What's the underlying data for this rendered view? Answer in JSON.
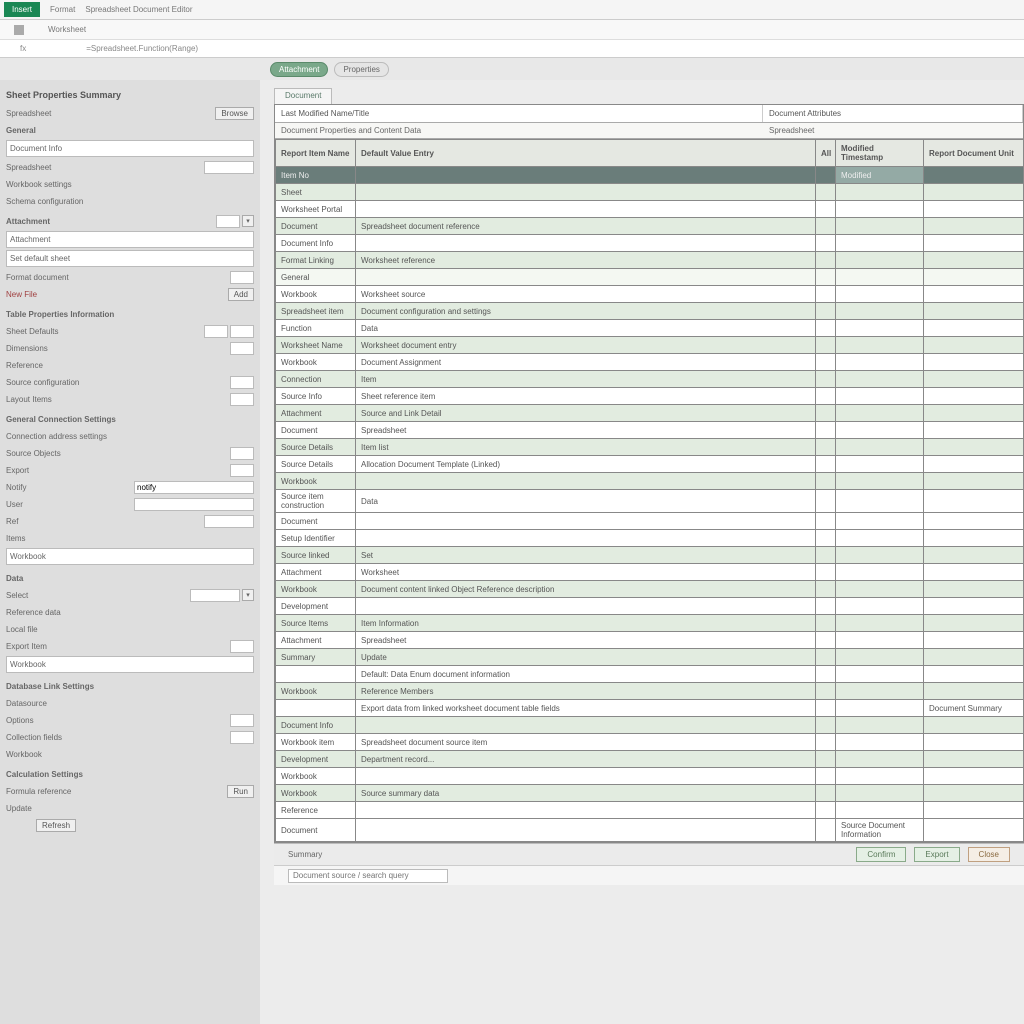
{
  "titlebar": {
    "tab": "Insert",
    "text1": "Format",
    "text2": "Spreadsheet Document Editor"
  },
  "ribbon": {
    "name": "Worksheet"
  },
  "formula": {
    "fx": "fx",
    "content": "=Spreadsheet.Function(Range)"
  },
  "chips": {
    "c1": "Attachment",
    "c2": "Properties"
  },
  "sidebar": {
    "title": "Sheet Properties Summary",
    "sub": "Spreadsheet",
    "group1_h": "General",
    "r1": {
      "label": "Document Info",
      "btn": "Browse"
    },
    "r2": {
      "label": "Spreadsheet"
    },
    "r3": {
      "label": "Workbook settings"
    },
    "r4": {
      "label": "Schema configuration"
    },
    "g2h": "Attachment",
    "r5": {
      "label": "Attachment"
    },
    "r6": {
      "label": "Set default sheet"
    },
    "r7": {
      "label": "Format document"
    },
    "r8": {
      "label": "New File",
      "btn": "Add"
    },
    "g3h": "Table Properties Information",
    "r9": {
      "label": "Sheet Defaults"
    },
    "r10": {
      "label": "Dimensions"
    },
    "r11": {
      "label": "Reference"
    },
    "r12": {
      "label": "Source configuration"
    },
    "r13": {
      "label": "Layout Items"
    },
    "g4h": "General Connection Settings",
    "r14": {
      "label": "Connection address settings"
    },
    "r15": {
      "label": "Source Objects"
    },
    "r16": {
      "label": "Export"
    },
    "r17": {
      "label": "Notify",
      "val": "notify"
    },
    "r18": {
      "label": "User"
    },
    "r19": {
      "label": "Ref"
    },
    "r20": {
      "label": "Items"
    },
    "r21": {
      "label": "Workbook"
    },
    "g5h": "Data",
    "r22": {
      "label": "Select"
    },
    "r23": {
      "label": "Reference data"
    },
    "r24": {
      "label": "Local file"
    },
    "r25": {
      "label": "Export Item"
    },
    "r26": {
      "label": "Workbook"
    },
    "g6h": "Database Link Settings",
    "r27": {
      "label": "Datasource"
    },
    "r28": {
      "label": "Options"
    },
    "r29": {
      "label": "Collection fields"
    },
    "r30": {
      "label": "Workbook"
    },
    "g7h": "Calculation Settings",
    "r31": {
      "label": "Formula reference"
    },
    "r32": {
      "label": "Update",
      "btn": "Run"
    },
    "r33": {
      "label": "Refresh"
    }
  },
  "sheet": {
    "tab": "Document",
    "hdr1": "Last Modified Name/Title",
    "hdr2": "Document Attributes",
    "sub1": "Document Properties and Content Data",
    "sub2": "Spreadsheet",
    "cols": {
      "c1": "Report Item Name",
      "c2": "Default Value Entry",
      "c3": "All",
      "c4": "Modified Timestamp",
      "c5": "Report Document Unit"
    },
    "rows": [
      {
        "t": "dk",
        "c1": "Item No",
        "c2": "",
        "c3": "",
        "c4": "Modified",
        "c5": ""
      },
      {
        "t": "gr",
        "c1": "Sheet",
        "c2": "",
        "c3": "",
        "c4": "",
        "c5": ""
      },
      {
        "t": "",
        "c1": "Worksheet Portal",
        "c2": "",
        "c3": "",
        "c4": "",
        "c5": ""
      },
      {
        "t": "gr",
        "c1": "Document",
        "c2": "Spreadsheet document reference",
        "c3": "",
        "c4": "",
        "c5": ""
      },
      {
        "t": "",
        "c1": "Document Info",
        "c2": "",
        "c3": "",
        "c4": "",
        "c5": ""
      },
      {
        "t": "gr",
        "c1": "Format Linking",
        "c2": "Worksheet reference",
        "c3": "",
        "c4": "",
        "c5": ""
      },
      {
        "t": "lt",
        "c1": "General",
        "c2": "",
        "c3": "",
        "c4": "",
        "c5": ""
      },
      {
        "t": "",
        "c1": "Workbook",
        "c2": "Worksheet source",
        "c3": "",
        "c4": "",
        "c5": ""
      },
      {
        "t": "gr",
        "c1": "Spreadsheet item",
        "c2": "Document configuration and settings",
        "c3": "",
        "c4": "",
        "c5": ""
      },
      {
        "t": "",
        "c1": "Function",
        "c2": "Data",
        "c3": "",
        "c4": "",
        "c5": ""
      },
      {
        "t": "gr",
        "c1": "Worksheet Name",
        "c2": "Worksheet document entry",
        "c3": "",
        "c4": "",
        "c5": ""
      },
      {
        "t": "",
        "c1": "Workbook",
        "c2": "Document Assignment",
        "c3": "",
        "c4": "",
        "c5": ""
      },
      {
        "t": "gr",
        "c1": "Connection",
        "c2": "Item",
        "c3": "",
        "c4": "",
        "c5": ""
      },
      {
        "t": "",
        "c1": "Source Info",
        "c2": "Sheet reference item",
        "c3": "",
        "c4": "",
        "c5": ""
      },
      {
        "t": "gr",
        "c1": "Attachment",
        "c2": "Source and Link Detail",
        "c3": "",
        "c4": "",
        "c5": ""
      },
      {
        "t": "",
        "c1": "Document",
        "c2": "Spreadsheet",
        "c3": "",
        "c4": "",
        "c5": ""
      },
      {
        "t": "gr",
        "c1": "Source Details",
        "c2": "Item list",
        "c3": "",
        "c4": "",
        "c5": ""
      },
      {
        "t": "",
        "c1": "Source Details",
        "c2": "Allocation Document Template (Linked)",
        "c3": "",
        "c4": "",
        "c5": ""
      },
      {
        "t": "gr",
        "c1": "Workbook",
        "c2": "",
        "c3": "",
        "c4": "",
        "c5": ""
      },
      {
        "t": "",
        "c1": "Source item construction",
        "c2": "Data",
        "c3": "",
        "c4": "",
        "c5": ""
      },
      {
        "t": "",
        "c1": "Document",
        "c2": "",
        "c3": "",
        "c4": "",
        "c5": ""
      },
      {
        "t": "",
        "c1": "Setup Identifier",
        "c2": "",
        "c3": "",
        "c4": "",
        "c5": ""
      },
      {
        "t": "gr",
        "c1": "Source linked",
        "c2": "Set",
        "c3": "",
        "c4": "",
        "c5": ""
      },
      {
        "t": "",
        "c1": "Attachment",
        "c2": "Worksheet",
        "c3": "",
        "c4": "",
        "c5": ""
      },
      {
        "t": "gr",
        "c1": "Workbook",
        "c2": "Document content linked Object Reference description",
        "c3": "",
        "c4": "",
        "c5": ""
      },
      {
        "t": "",
        "c1": "Development",
        "c2": "",
        "c3": "",
        "c4": "",
        "c5": ""
      },
      {
        "t": "gr",
        "c1": "Source Items",
        "c2": "Item Information",
        "c3": "",
        "c4": "",
        "c5": ""
      },
      {
        "t": "",
        "c1": "Attachment",
        "c2": "Spreadsheet",
        "c3": "",
        "c4": "",
        "c5": ""
      },
      {
        "t": "gr",
        "c1": "Summary",
        "c2": "Update",
        "c3": "",
        "c4": "",
        "c5": ""
      },
      {
        "t": "",
        "c1": "",
        "c2": "Default: Data Enum document information",
        "c3": "",
        "c4": "",
        "c5": ""
      },
      {
        "t": "gr",
        "c1": "Workbook",
        "c2": "Reference Members",
        "c3": "",
        "c4": "",
        "c5": ""
      },
      {
        "t": "",
        "c1": "",
        "c2": "Export data from linked worksheet document table fields",
        "c3": "",
        "c4": "",
        "c5": "Document Summary"
      },
      {
        "t": "gr",
        "c1": "Document Info",
        "c2": "",
        "c3": "",
        "c4": "",
        "c5": ""
      },
      {
        "t": "",
        "c1": "Workbook item",
        "c2": "Spreadsheet document source item",
        "c3": "",
        "c4": "",
        "c5": ""
      },
      {
        "t": "gr",
        "c1": "Development",
        "c2": "Department record...",
        "c3": "",
        "c4": "",
        "c5": ""
      },
      {
        "t": "",
        "c1": "Workbook",
        "c2": "",
        "c3": "",
        "c4": "",
        "c5": ""
      },
      {
        "t": "gr",
        "c1": "Workbook",
        "c2": "Source summary data",
        "c3": "",
        "c4": "",
        "c5": ""
      },
      {
        "t": "",
        "c1": "Reference",
        "c2": "",
        "c3": "",
        "c4": "",
        "c5": ""
      },
      {
        "t": "",
        "c1": "Document",
        "c2": "",
        "c3": "",
        "c4": "Source Document Information",
        "c5": ""
      }
    ]
  },
  "footer": {
    "label": "Summary",
    "b1": "Confirm",
    "b2": "Export",
    "b3": "Close"
  },
  "search": {
    "placeholder": "Document source / search query"
  }
}
